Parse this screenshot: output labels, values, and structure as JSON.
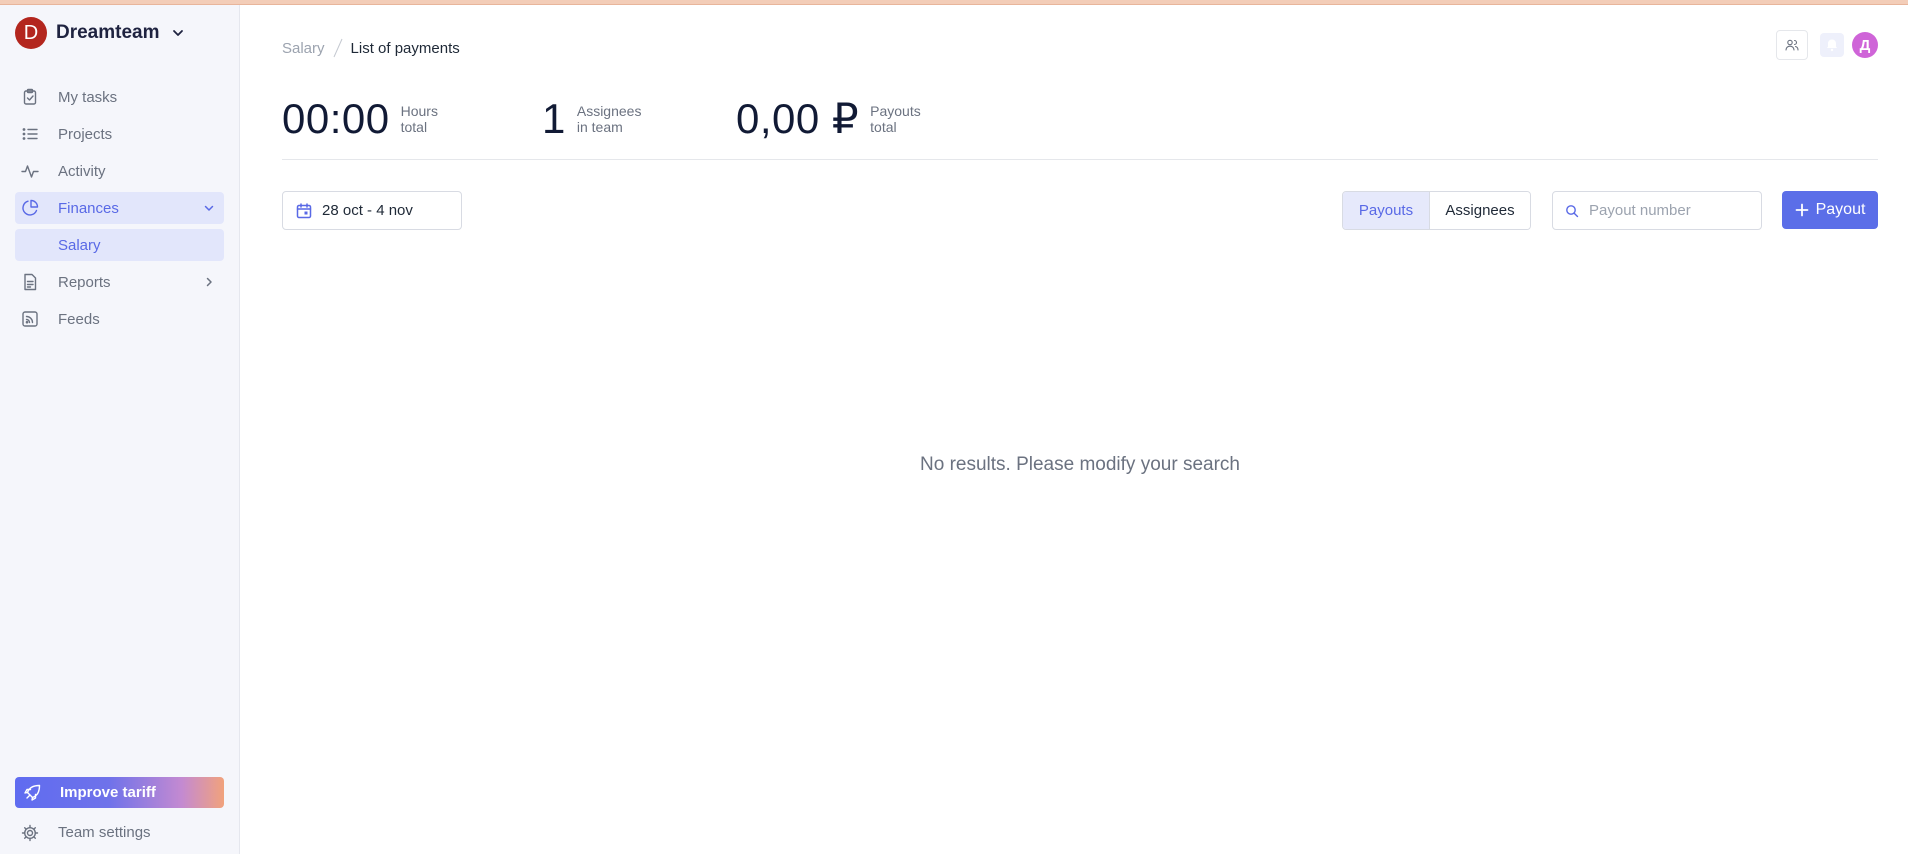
{
  "team": {
    "initial": "D",
    "name": "Dreamteam"
  },
  "sidebar": {
    "items": [
      {
        "label": "My tasks",
        "icon": "clipboard-icon"
      },
      {
        "label": "Projects",
        "icon": "list-icon"
      },
      {
        "label": "Activity",
        "icon": "activity-icon"
      },
      {
        "label": "Finances",
        "icon": "pie-chart-icon"
      },
      {
        "label": "Salary"
      },
      {
        "label": "Reports",
        "icon": "document-icon"
      },
      {
        "label": "Feeds",
        "icon": "rss-icon"
      }
    ],
    "improve_tariff": "Improve tariff",
    "team_settings": "Team settings"
  },
  "header": {
    "breadcrumb": {
      "parent": "Salary",
      "current": "List of payments"
    },
    "user_initial": "Д"
  },
  "stats": {
    "hours": {
      "value": "00:00",
      "label_line1": "Hours",
      "label_line2": "total"
    },
    "assignees": {
      "value": "1",
      "label_line1": "Assignees",
      "label_line2": "in team"
    },
    "payouts": {
      "value": "0,00 ₽",
      "label_line1": "Payouts",
      "label_line2": "total"
    }
  },
  "toolbar": {
    "date_range": "28 oct - 4 nov",
    "tabs": [
      "Payouts",
      "Assignees"
    ],
    "active_tab": "Payouts",
    "search_placeholder": "Payout number",
    "search_value": "",
    "payout_button": "Payout"
  },
  "empty_message": "No results. Please modify your search",
  "colors": {
    "accent": "#5b6ee8",
    "active_bg": "#e2e6fb",
    "team_avatar": "#b3261e",
    "user_avatar": "#cf64d8"
  }
}
